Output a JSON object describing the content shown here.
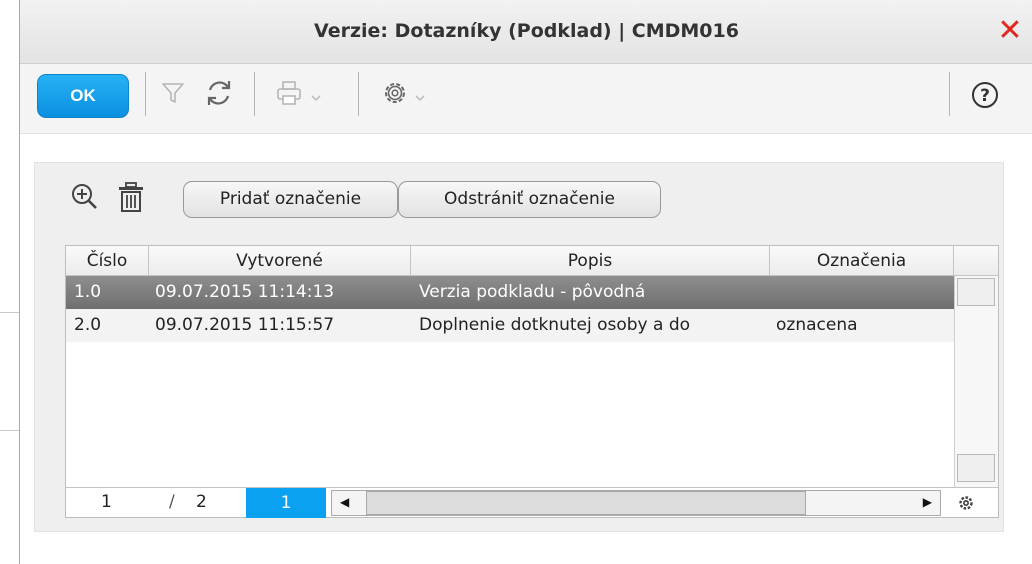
{
  "window": {
    "title": "Verzie: Dotazníky (Podklad) | CMDM016",
    "close_glyph": "✕"
  },
  "toolbar": {
    "ok_label": "OK",
    "help_glyph": "?",
    "icons": [
      "filter-icon",
      "refresh-icon",
      "print-icon",
      "settings-icon",
      "help-icon"
    ]
  },
  "actions": {
    "add_label": "Pridať označenie",
    "remove_label": "Odstrániť označenie",
    "icons": [
      "zoom-in-icon",
      "trash-icon"
    ]
  },
  "grid": {
    "columns": [
      "Číslo",
      "Vytvorené",
      "Popis",
      "Označenia"
    ],
    "rows": [
      {
        "cislo": "1.0",
        "vytvorene": "09.07.2015 11:14:13",
        "popis": "Verzia podkladu - pôvodná",
        "oznacenia": ""
      },
      {
        "cislo": "2.0",
        "vytvorene": "09.07.2015 11:15:57",
        "popis": "Doplnenie dotknutej osoby a do",
        "oznacenia": "oznacena"
      }
    ],
    "selected_row": 0,
    "pager": {
      "current_page": "1",
      "separator": "/",
      "total_pages": "2",
      "page_button": "1"
    }
  },
  "colors": {
    "accent": "#0aa2f0",
    "close": "#e2261d",
    "selected_row": "#7a7a7a"
  }
}
